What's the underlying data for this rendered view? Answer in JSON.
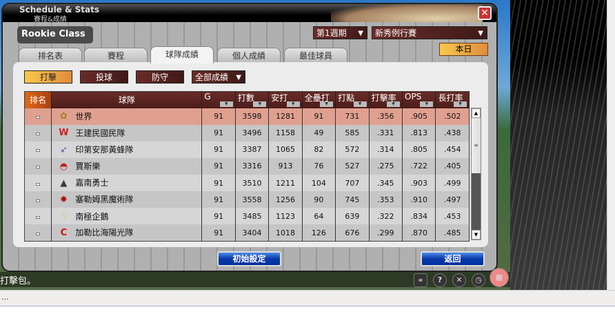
{
  "window": {
    "title_en": "Schedule & Stats",
    "title_zh": "賽程&成績",
    "league": "Rookie Class"
  },
  "tabs": [
    {
      "label": "排名表"
    },
    {
      "label": "賽程"
    },
    {
      "label": "球隊成績",
      "active": true
    },
    {
      "label": "個人成績"
    },
    {
      "label": "最佳球員"
    }
  ],
  "filters": {
    "period": "第1週期",
    "season": "新秀例行賽",
    "today": "本日"
  },
  "categories": {
    "batting": "打擊",
    "pitching": "投球",
    "fielding": "防守",
    "scope": "全部成績"
  },
  "table": {
    "headers": [
      "排名",
      "球隊",
      "G",
      "打數",
      "安打",
      "全壘打",
      "打點",
      "打擊率",
      "OPS",
      "長打率"
    ],
    "rows": [
      {
        "team": "世界",
        "logo": "bee-logo",
        "g": "91",
        "ab": "3598",
        "h": "1281",
        "hr": "91",
        "rbi": "731",
        "avg": ".356",
        "ops": ".905",
        "slg": ".502"
      },
      {
        "team": "王建民國民隊",
        "logo": "W-logo",
        "g": "91",
        "ab": "3496",
        "h": "1158",
        "hr": "49",
        "rbi": "585",
        "avg": ".331",
        "ops": ".813",
        "slg": ".438"
      },
      {
        "team": "印第安那黃蜂隊",
        "logo": "hornet-logo",
        "g": "91",
        "ab": "3387",
        "h": "1065",
        "hr": "82",
        "rbi": "572",
        "avg": ".314",
        "ops": ".805",
        "slg": ".454"
      },
      {
        "team": "賈斯樂",
        "logo": "cap-logo",
        "g": "91",
        "ab": "3316",
        "h": "913",
        "hr": "76",
        "rbi": "527",
        "avg": ".275",
        "ops": ".722",
        "slg": ".405"
      },
      {
        "team": "嘉南勇士",
        "logo": "warrior-logo",
        "g": "91",
        "ab": "3510",
        "h": "1211",
        "hr": "104",
        "rbi": "707",
        "avg": ".345",
        "ops": ".903",
        "slg": ".499"
      },
      {
        "team": "塞勒姆黑魔術隊",
        "logo": "devil-logo",
        "g": "91",
        "ab": "3558",
        "h": "1256",
        "hr": "90",
        "rbi": "745",
        "avg": ".353",
        "ops": ".910",
        "slg": ".497"
      },
      {
        "team": "南極企鵝",
        "logo": "S-logo",
        "g": "91",
        "ab": "3485",
        "h": "1123",
        "hr": "64",
        "rbi": "639",
        "avg": ".322",
        "ops": ".834",
        "slg": ".453"
      },
      {
        "team": "加勒比海陽光隊",
        "logo": "C-logo",
        "g": "91",
        "ab": "3404",
        "h": "1018",
        "hr": "126",
        "rbi": "676",
        "avg": ".299",
        "ops": ".870",
        "slg": ".485"
      }
    ]
  },
  "buttons": {
    "reset": "初始設定",
    "back": "返回"
  },
  "ticker": "打擊包。",
  "status": "..."
}
